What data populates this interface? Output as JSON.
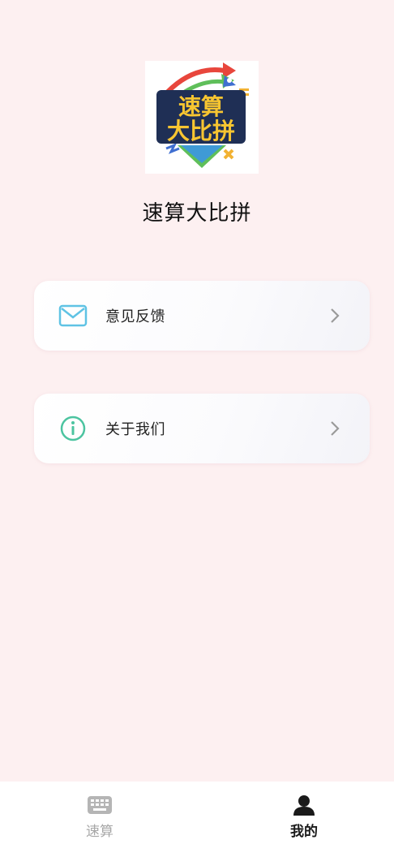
{
  "app": {
    "name": "速算大比拼",
    "logo_line1": "速算",
    "logo_line2": "大比拼"
  },
  "menu": [
    {
      "label": "意见反馈",
      "icon": "mail-icon"
    },
    {
      "label": "关于我们",
      "icon": "info-icon"
    }
  ],
  "tabs": [
    {
      "label": "速算",
      "icon": "keyboard-icon",
      "active": false
    },
    {
      "label": "我的",
      "icon": "person-icon",
      "active": true
    }
  ],
  "colors": {
    "background": "#fdf0f1",
    "mail_icon": "#5fc3e4",
    "info_icon": "#4cc4a0",
    "chevron": "#9a9a9a",
    "tab_inactive": "#a8a8a8",
    "tab_active": "#1a1a1a"
  }
}
